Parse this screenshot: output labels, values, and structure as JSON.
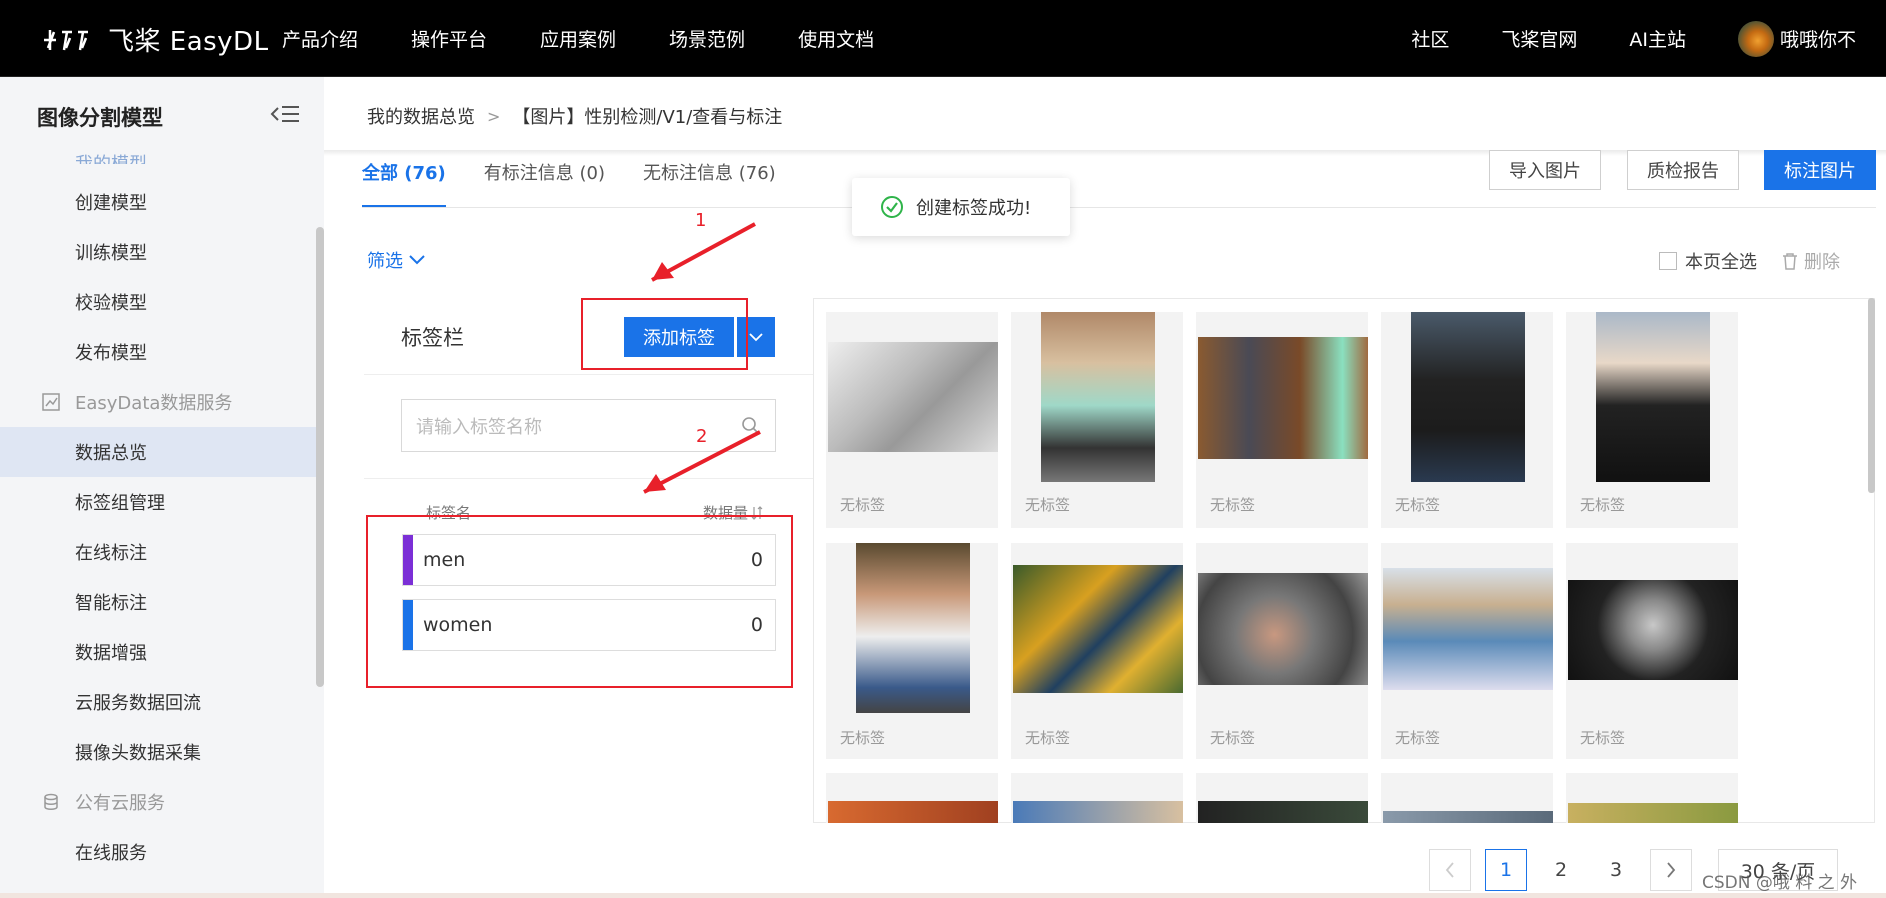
{
  "topbar": {
    "brand": "飞桨 EasyDL",
    "nav": [
      "产品介绍",
      "操作平台",
      "应用案例",
      "场景范例",
      "使用文档"
    ],
    "nav_right": [
      "社区",
      "飞桨官网",
      "AI主站"
    ],
    "username": "哦哦你不"
  },
  "sidebar": {
    "title": "图像分割模型",
    "items": [
      {
        "label": "我的模型",
        "type": "item"
      },
      {
        "label": "创建模型",
        "type": "item"
      },
      {
        "label": "训练模型",
        "type": "item"
      },
      {
        "label": "校验模型",
        "type": "item"
      },
      {
        "label": "发布模型",
        "type": "item"
      },
      {
        "label": "EasyData数据服务",
        "type": "group",
        "icon": "chart-icon"
      },
      {
        "label": "数据总览",
        "type": "item",
        "active": true
      },
      {
        "label": "标签组管理",
        "type": "item"
      },
      {
        "label": "在线标注",
        "type": "item"
      },
      {
        "label": "智能标注",
        "type": "item"
      },
      {
        "label": "数据增强",
        "type": "item"
      },
      {
        "label": "云服务数据回流",
        "type": "item"
      },
      {
        "label": "摄像头数据采集",
        "type": "item"
      },
      {
        "label": "公有云服务",
        "type": "group",
        "icon": "database-icon"
      },
      {
        "label": "在线服务",
        "type": "item"
      }
    ]
  },
  "breadcrumb": {
    "root": "我的数据总览",
    "current": "【图片】性别检测/V1/查看与标注",
    "sep": ">"
  },
  "tabs": [
    {
      "label": "全部 (76)",
      "active": true
    },
    {
      "label": "有标注信息 (0)"
    },
    {
      "label": "无标注信息 (76)"
    }
  ],
  "toolbar": {
    "import": "导入图片",
    "quality": "质检报告",
    "annotate": "标注图片"
  },
  "toast": {
    "text": "创建标签成功!"
  },
  "filter": {
    "label": "筛选"
  },
  "select_all": {
    "label": "本页全选",
    "delete": "删除"
  },
  "label_panel": {
    "title": "标签栏",
    "add_button": "添加标签",
    "search_placeholder": "请输入标签名称",
    "col_name": "标签名",
    "col_count": "数据量",
    "labels": [
      {
        "name": "men",
        "count": "0",
        "color": "#7b2fd6"
      },
      {
        "name": "women",
        "count": "0",
        "color": "#1a73e8"
      }
    ]
  },
  "annotations": {
    "n1": "1",
    "n2": "2"
  },
  "images": [
    {
      "caption": "无标签"
    },
    {
      "caption": "无标签"
    },
    {
      "caption": "无标签"
    },
    {
      "caption": "无标签"
    },
    {
      "caption": "无标签"
    },
    {
      "caption": "无标签"
    },
    {
      "caption": "无标签"
    },
    {
      "caption": "无标签"
    },
    {
      "caption": "无标签"
    },
    {
      "caption": "无标签"
    }
  ],
  "pagination": {
    "pages": [
      "1",
      "2",
      "3"
    ],
    "current": "1",
    "page_size": "30 条/页"
  },
  "watermark": "CSDN @哦 料 之 外"
}
